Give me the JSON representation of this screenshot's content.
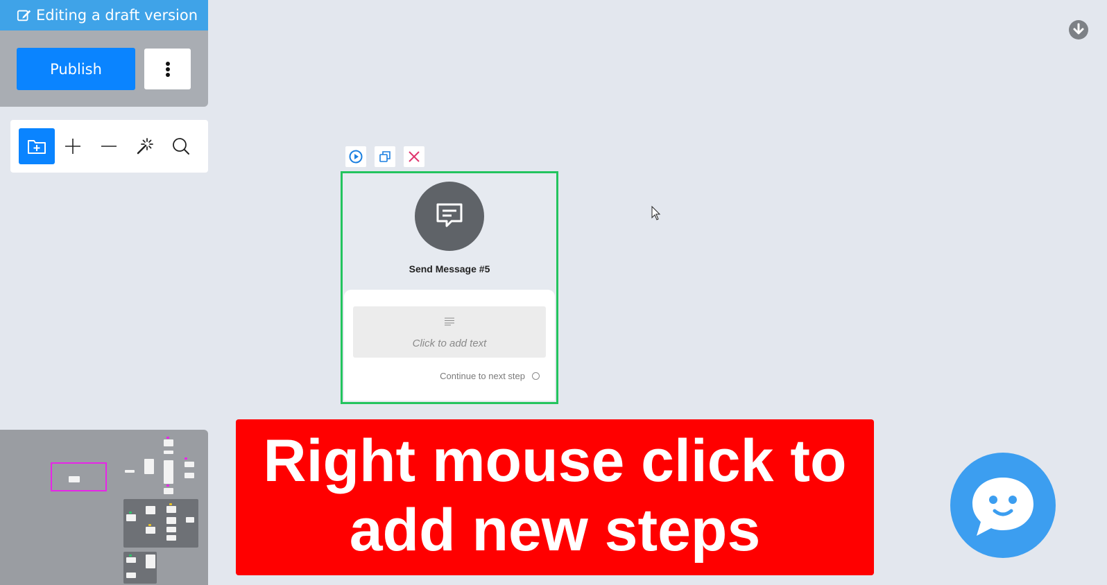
{
  "draft": {
    "banner_text": "Editing a draft version",
    "publish_label": "Publish",
    "more_icon": "vertical-ellipsis-icon"
  },
  "toolbar": {
    "tools": [
      {
        "name": "new-folder",
        "icon": "folder-plus-icon",
        "active": true
      },
      {
        "name": "zoom-in",
        "icon": "plus-icon",
        "active": false
      },
      {
        "name": "zoom-out",
        "icon": "minus-icon",
        "active": false
      },
      {
        "name": "auto-arrange",
        "icon": "magic-wand-icon",
        "active": false
      },
      {
        "name": "search",
        "icon": "search-icon",
        "active": false
      }
    ]
  },
  "node": {
    "title": "Send Message #5",
    "text_placeholder": "Click to add text",
    "continue_label": "Continue to next step",
    "actions": [
      "play-icon",
      "duplicate-icon",
      "delete-icon"
    ],
    "avatar_icon": "message-icon",
    "selected_color": "#23c45e"
  },
  "overlay": {
    "line1": "Right mouse click to",
    "line2": "add new steps"
  },
  "colors": {
    "canvas": "#e3e7ee",
    "primary": "#0a84ff",
    "banner_bg": "#ff0000",
    "chat_widget": "#3c9ef0",
    "minimap_highlight": "#e824e8"
  }
}
